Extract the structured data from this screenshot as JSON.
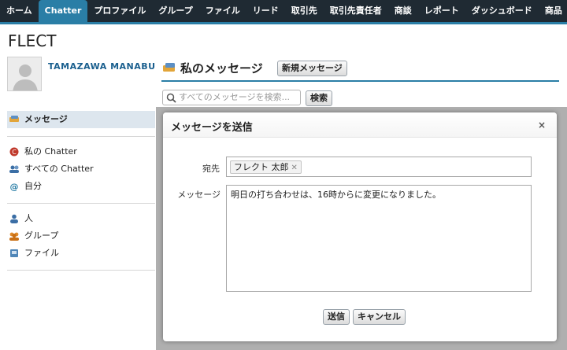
{
  "nav": {
    "tabs": [
      "ホーム",
      "Chatter",
      "プロファイル",
      "グループ",
      "ファイル",
      "リード",
      "取引先",
      "取引先責任者",
      "商談",
      "レポート",
      "ダッシュボード",
      "商品"
    ],
    "active_tab": "Chatter",
    "colors": {
      "bar": "#1f2a33",
      "accent": "#2a7ea6"
    }
  },
  "org_name": "FLECT",
  "user": {
    "name": "TAMAZAWA MANABU"
  },
  "sidebar": {
    "messages_label": "メッセージ",
    "group1": [
      {
        "label": "私の Chatter",
        "icon": "chatter-icon"
      },
      {
        "label": "すべての Chatter",
        "icon": "people-icon"
      },
      {
        "label": "自分",
        "icon": "at-icon"
      }
    ],
    "group2": [
      {
        "label": "人",
        "icon": "person-icon"
      },
      {
        "label": "グループ",
        "icon": "group-icon"
      },
      {
        "label": "ファイル",
        "icon": "file-icon"
      }
    ]
  },
  "messages": {
    "title": "私のメッセージ",
    "new_button": "新規メッセージ",
    "search_placeholder": "すべてのメッセージを検索...",
    "search_button": "検索"
  },
  "dialog": {
    "title": "メッセージを送信",
    "close": "×",
    "to_label": "宛先",
    "recipient": "フレクト 太郎",
    "message_label": "メッセージ",
    "message_text": "明日の打ち合わせは、16時からに変更になりました。",
    "send_button": "送信",
    "cancel_button": "キャンセル"
  }
}
